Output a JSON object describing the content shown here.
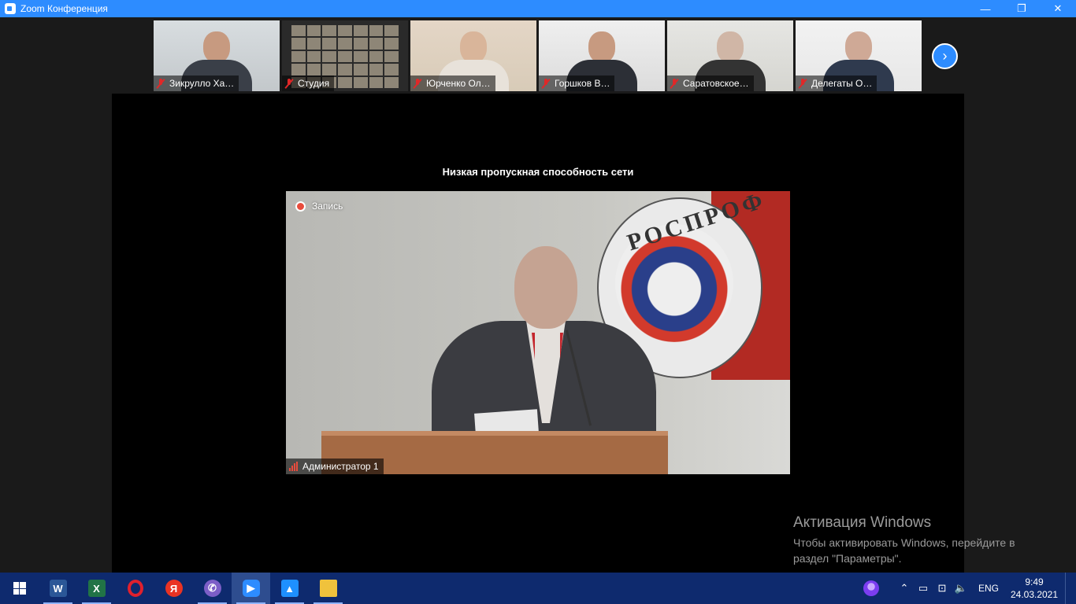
{
  "window": {
    "title": "Zoom Конференция",
    "controls": {
      "minimize": "—",
      "maximize": "❐",
      "close": "✕"
    }
  },
  "gallery": {
    "participants": [
      {
        "name": "Зикрулло Ха…",
        "muted": true
      },
      {
        "name": "Студия",
        "muted": true
      },
      {
        "name": "Юрченко Ол…",
        "muted": true
      },
      {
        "name": "Горшков В…",
        "muted": true
      },
      {
        "name": "Саратовское…",
        "muted": true
      },
      {
        "name": "Делегаты О…",
        "muted": true
      }
    ],
    "next_icon": "›"
  },
  "main": {
    "network_warning": "Низкая пропускная способность сети",
    "recording_label": "Запись",
    "active_speaker": "Администратор 1",
    "logo_text": "РОСПРОФ"
  },
  "activation": {
    "title": "Активация Windows",
    "line1": "Чтобы активировать Windows, перейдите в",
    "line2": "раздел \"Параметры\"."
  },
  "taskbar": {
    "apps": [
      {
        "icon": "word-icon",
        "glyph": "W"
      },
      {
        "icon": "excel-icon",
        "glyph": "X"
      },
      {
        "icon": "opera-icon",
        "glyph": ""
      },
      {
        "icon": "yandex-icon",
        "glyph": "Я"
      },
      {
        "icon": "viber-icon",
        "glyph": "✆"
      },
      {
        "icon": "zoom-icon",
        "glyph": "▶"
      },
      {
        "icon": "photos-icon",
        "glyph": "▲"
      },
      {
        "icon": "folder-icon",
        "glyph": ""
      }
    ],
    "language": "ENG",
    "time": "9:49",
    "date": "24.03.2021"
  },
  "colors": {
    "zoom_blue": "#2d8cff",
    "taskbar": "#0e2a6e",
    "muted_red": "#e02828"
  }
}
